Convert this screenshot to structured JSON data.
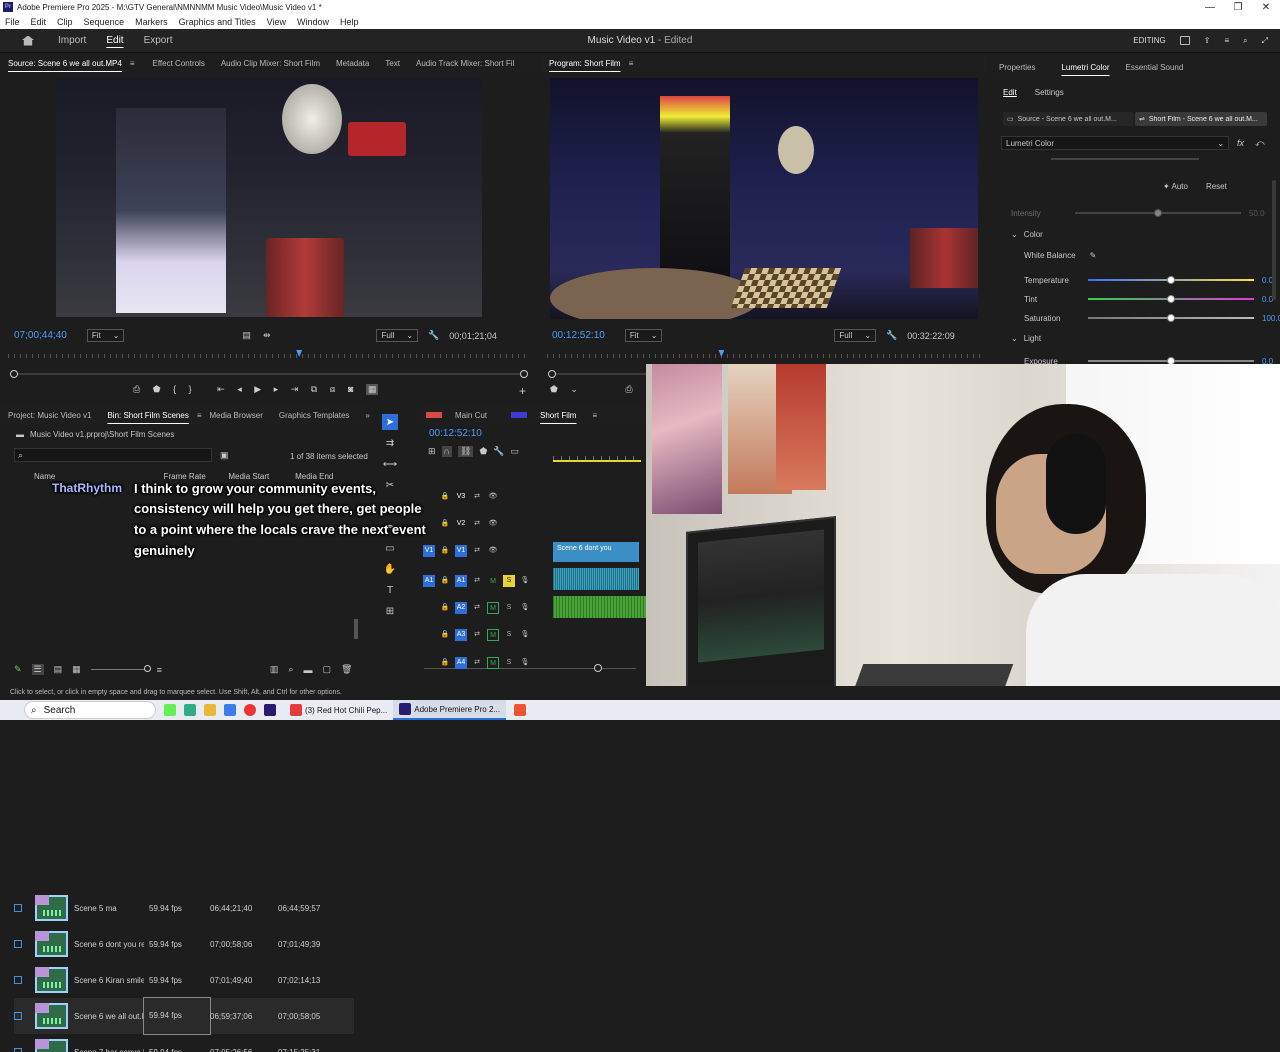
{
  "window": {
    "title": "Adobe Premiere Pro 2025 - M:\\GTV General\\NMNNMM Music Video\\Music Video v1 *"
  },
  "menu": [
    "File",
    "Edit",
    "Clip",
    "Sequence",
    "Markers",
    "Graphics and Titles",
    "View",
    "Window",
    "Help"
  ],
  "header": {
    "tabs": [
      "Import",
      "Edit",
      "Export"
    ],
    "active_tab": "Edit",
    "project_title": "Music Video v1",
    "edited": "- Edited",
    "workspace": "EDITING"
  },
  "source_panel": {
    "tabs": [
      "Source: Scene 6 we all out.MP4",
      "Effect Controls",
      "Audio Clip Mixer: Short Film",
      "Metadata",
      "Text",
      "Audio Track Mixer: Short Fil"
    ],
    "timecode": "07;00;44;40",
    "fit": "Fit",
    "resolution": "Full",
    "duration": "00;01;21;04",
    "playhead_fraction": 0.56
  },
  "program_panel": {
    "title": "Program: Short Film",
    "timecode": "00:12:52:10",
    "fit": "Fit",
    "resolution": "Full",
    "duration": "00:32:22:09",
    "playhead_fraction": 0.4
  },
  "lumetri": {
    "tabs": [
      "Properties",
      "Lumetri Color",
      "Essential Sound"
    ],
    "subtabs": [
      "Edit",
      "Settings"
    ],
    "source_chip": "Source - Scene 6 we all out.M...",
    "target_chip": "Short Film - Scene 6 we all out.M...",
    "effect": "Lumetri Color",
    "auto": "Auto",
    "reset": "Reset",
    "intensity": {
      "label": "Intensity",
      "value": "50.0",
      "fraction": 0.5
    },
    "color_section": "Color",
    "white_balance": "White Balance",
    "sliders": [
      {
        "label": "Temperature",
        "value": "0.0",
        "fraction": 0.5,
        "gradient": "linear-gradient(90deg,#3a6cff,#ffe23a)"
      },
      {
        "label": "Tint",
        "value": "0.0",
        "fraction": 0.5,
        "gradient": "linear-gradient(90deg,#2fd34a,#e13adf)"
      },
      {
        "label": "Saturation",
        "value": "100.0",
        "fraction": 0.5,
        "gradient": "linear-gradient(90deg,#777,#bbb)"
      }
    ],
    "light_section": "Light",
    "exposure": {
      "label": "Exposure",
      "value": "0.0",
      "fraction": 0.5
    }
  },
  "project": {
    "tabs": [
      "Project: Music Video v1",
      "Bin: Short Film Scenes",
      "Media Browser",
      "Graphics Templates"
    ],
    "path": "Music Video v1.prproj\\Short Film Scenes",
    "selection": "1 of 38 items selected",
    "columns": [
      "Name",
      "Frame Rate",
      "Media Start",
      "Media End"
    ],
    "rows": [
      {
        "name": "Scene 5 ma",
        "rate": "59.94 fps",
        "start": "06;44;21;40",
        "end": "06;44;59;57"
      },
      {
        "name": "Scene 6 dont you re",
        "rate": "59.94 fps",
        "start": "07;00;58;06",
        "end": "07;01;49;39"
      },
      {
        "name": "Scene 6 Kiran smiles.",
        "rate": "59.94 fps",
        "start": "07;01;49;40",
        "end": "07;02;14;13"
      },
      {
        "name": "Scene 6 we all out.M",
        "rate": "59.94 fps",
        "start": "06;59;37;06",
        "end": "07;00;58;05"
      },
      {
        "name": "Scene 7 bar convo.M",
        "rate": "59.94 fps",
        "start": "07;05;26;56",
        "end": "07;15;25;31"
      }
    ]
  },
  "timeline": {
    "tabs": [
      "Main Cut",
      "Short Film"
    ],
    "timecode": "00:12:52:10",
    "tracks": [
      "V3",
      "V2",
      "V1",
      "A1",
      "A2",
      "A3",
      "A4"
    ],
    "clip_label": "Scene 6 dont you"
  },
  "captions": {
    "channel": "ThatRhythm",
    "line1": "I think to grow your community events,",
    "line2": "consistency will help you get there, get people",
    "line3": "to a point where the locals crave the next event",
    "line4": "genuinely"
  },
  "status": "Click to select, or click in empty space and drag to marquee select. Use Shift, Alt, and Ctrl for other options.",
  "taskbar": {
    "search": "Search",
    "apps": [
      {
        "label": "(3) Red Hot Chili Pep...",
        "color": "#e53b3b"
      },
      {
        "label": "Adobe Premiere Pro 2...",
        "color": "#2b1b6e"
      }
    ]
  }
}
